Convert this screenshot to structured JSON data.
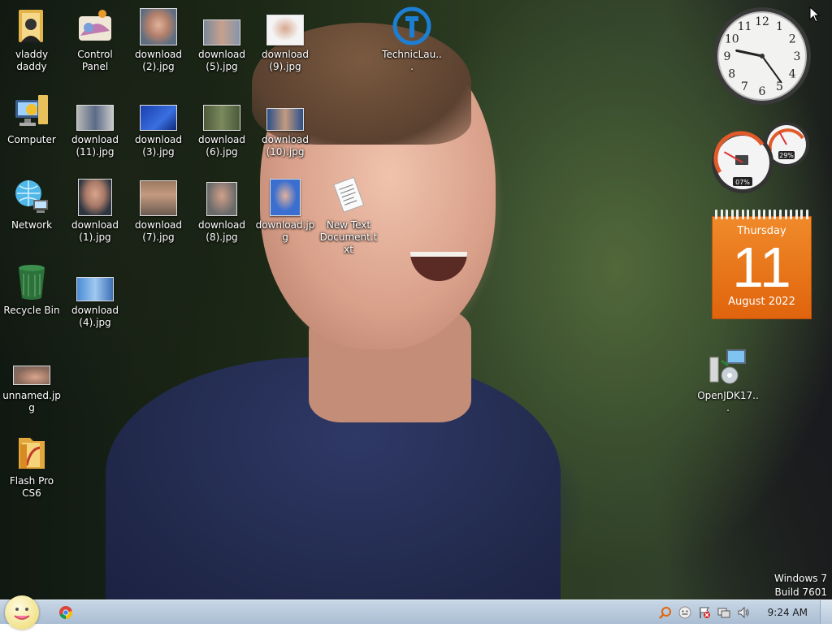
{
  "desktop": {
    "icons": [
      {
        "label": "vladdy daddy",
        "icon": "user-folder-icon"
      },
      {
        "label": "Control Panel",
        "icon": "control-panel-icon"
      },
      {
        "label": "download (2).jpg",
        "icon": "image-thumbnail"
      },
      {
        "label": "download (5).jpg",
        "icon": "image-thumbnail"
      },
      {
        "label": "download (9).jpg",
        "icon": "image-thumbnail"
      },
      {
        "label": "TechnicLau...",
        "icon": "technic-launcher-icon"
      },
      {
        "label": "Computer",
        "icon": "computer-icon"
      },
      {
        "label": "download (11).jpg",
        "icon": "image-thumbnail"
      },
      {
        "label": "download (3).jpg",
        "icon": "image-thumbnail"
      },
      {
        "label": "download (6).jpg",
        "icon": "image-thumbnail"
      },
      {
        "label": "download (10).jpg",
        "icon": "image-thumbnail"
      },
      {
        "label": "Network",
        "icon": "network-icon"
      },
      {
        "label": "download (1).jpg",
        "icon": "image-thumbnail"
      },
      {
        "label": "download (7).jpg",
        "icon": "image-thumbnail"
      },
      {
        "label": "download (8).jpg",
        "icon": "image-thumbnail"
      },
      {
        "label": "download.jpg",
        "icon": "image-thumbnail"
      },
      {
        "label": "New Text Document.txt",
        "icon": "text-document-icon"
      },
      {
        "label": "Recycle Bin",
        "icon": "recycle-bin-icon"
      },
      {
        "label": "download (4).jpg",
        "icon": "image-thumbnail"
      },
      {
        "label": "unnamed.jpg",
        "icon": "image-thumbnail"
      },
      {
        "label": "Flash Pro CS6",
        "icon": "flash-pro-folder-icon"
      },
      {
        "label": "OpenJDK17...",
        "icon": "installer-icon"
      }
    ]
  },
  "gadgets": {
    "clock": {
      "hour": 9,
      "minute": 24,
      "numerals": [
        "12",
        "1",
        "2",
        "3",
        "4",
        "5",
        "6",
        "7",
        "8",
        "9",
        "10",
        "11"
      ]
    },
    "cpu_meter": {
      "cpu_percent_label": "07%",
      "memory_percent_label": "29%",
      "cpu": 7,
      "memory": 29
    },
    "calendar": {
      "weekday": "Thursday",
      "day": "11",
      "month_year": "August 2022"
    }
  },
  "watermark": {
    "line1": "Windows 7",
    "line2": "Build 7601"
  },
  "taskbar": {
    "pinned": [
      {
        "name": "Google Chrome",
        "icon": "chrome-icon"
      }
    ],
    "tray_icons": [
      "search-tool-icon",
      "smiley-icon",
      "action-center-icon",
      "network-tray-icon",
      "volume-icon"
    ],
    "time": "9:24 AM"
  },
  "colors": {
    "taskbar": "#b8c9dc",
    "calendar_orange": "#e8731a",
    "chrome_red": "#db4437",
    "chrome_yellow": "#f4c20d",
    "chrome_green": "#0f9d58",
    "chrome_blue": "#4285f4"
  }
}
